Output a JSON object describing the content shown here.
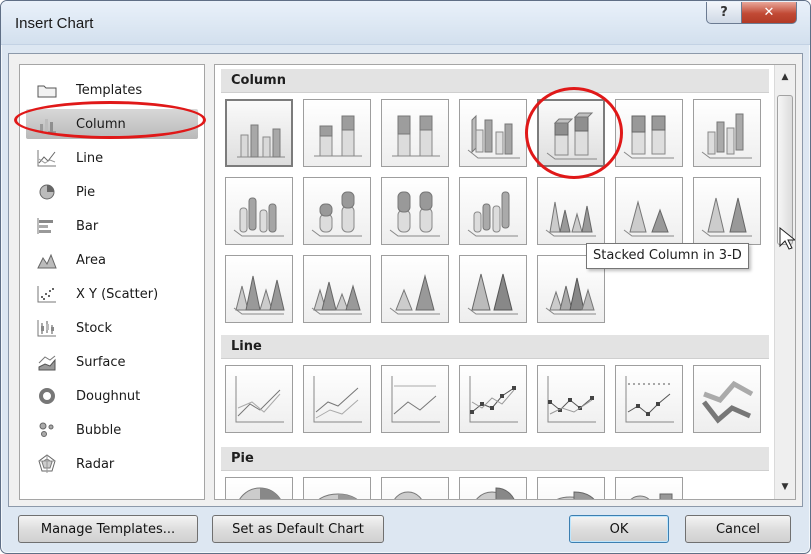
{
  "dialog": {
    "title": "Insert Chart"
  },
  "titlebar": {
    "help_symbol": "?",
    "close_symbol": "✕"
  },
  "sidebar": {
    "items": [
      {
        "label": "Templates",
        "icon": "folder-icon"
      },
      {
        "label": "Column",
        "icon": "column-chart-icon",
        "selected": true
      },
      {
        "label": "Line",
        "icon": "line-chart-icon"
      },
      {
        "label": "Pie",
        "icon": "pie-chart-icon"
      },
      {
        "label": "Bar",
        "icon": "bar-chart-icon"
      },
      {
        "label": "Area",
        "icon": "area-chart-icon"
      },
      {
        "label": "X Y (Scatter)",
        "icon": "scatter-chart-icon"
      },
      {
        "label": "Stock",
        "icon": "stock-chart-icon"
      },
      {
        "label": "Surface",
        "icon": "surface-chart-icon"
      },
      {
        "label": "Doughnut",
        "icon": "doughnut-chart-icon"
      },
      {
        "label": "Bubble",
        "icon": "bubble-chart-icon"
      },
      {
        "label": "Radar",
        "icon": "radar-chart-icon"
      }
    ]
  },
  "gallery": {
    "sections": [
      {
        "title": "Column"
      },
      {
        "title": "Line"
      },
      {
        "title": "Pie"
      }
    ],
    "hovered_thumbnail": "Stacked Column in 3-D"
  },
  "tooltip": {
    "text": "Stacked Column in 3-D"
  },
  "buttons": {
    "manage_templates": "Manage Templates...",
    "set_default": "Set as Default Chart",
    "ok": "OK",
    "cancel": "Cancel"
  },
  "colors": {
    "highlight_ellipse": "#e01818",
    "selection": "#c4c4c4"
  }
}
